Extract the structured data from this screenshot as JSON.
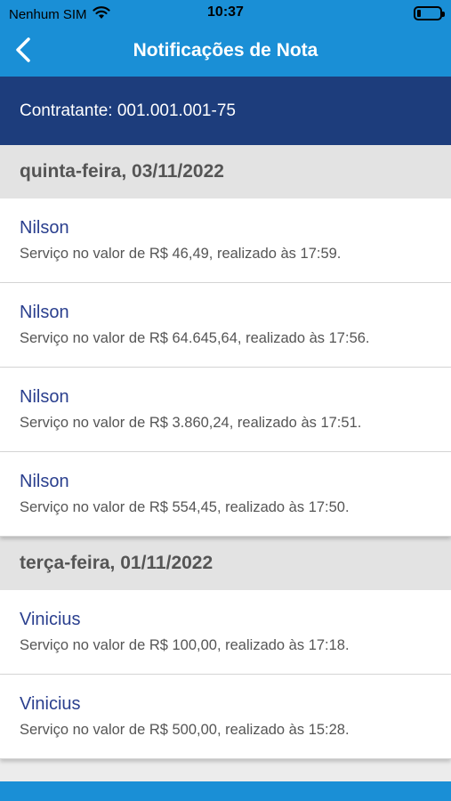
{
  "status": {
    "carrier": "Nenhum SIM",
    "time": "10:37"
  },
  "nav": {
    "title": "Notificações de Nota"
  },
  "contractor": {
    "text": "Contratante: 001.001.001-75"
  },
  "sections": [
    {
      "date": "quinta-feira, 03/11/2022",
      "items": [
        {
          "name": "Nilson",
          "desc": "Serviço no valor de R$ 46,49, realizado às 17:59."
        },
        {
          "name": "Nilson",
          "desc": "Serviço no valor de R$ 64.645,64, realizado às 17:56."
        },
        {
          "name": "Nilson",
          "desc": "Serviço no valor de R$ 3.860,24, realizado às 17:51."
        },
        {
          "name": "Nilson",
          "desc": "Serviço no valor de R$ 554,45, realizado às 17:50."
        }
      ]
    },
    {
      "date": "terça-feira, 01/11/2022",
      "items": [
        {
          "name": "Vinicius",
          "desc": "Serviço no valor de R$ 100,00, realizado às 17:18."
        },
        {
          "name": "Vinicius",
          "desc": "Serviço no valor de R$ 500,00, realizado às 15:28."
        }
      ]
    }
  ],
  "colors": {
    "header_blue": "#1a8fd6",
    "contractor_navy": "#1d3d7c",
    "name_blue": "#2a3f8e"
  },
  "icons": {
    "wifi": "wifi-icon",
    "battery": "battery-icon",
    "back": "chevron-left-icon"
  }
}
